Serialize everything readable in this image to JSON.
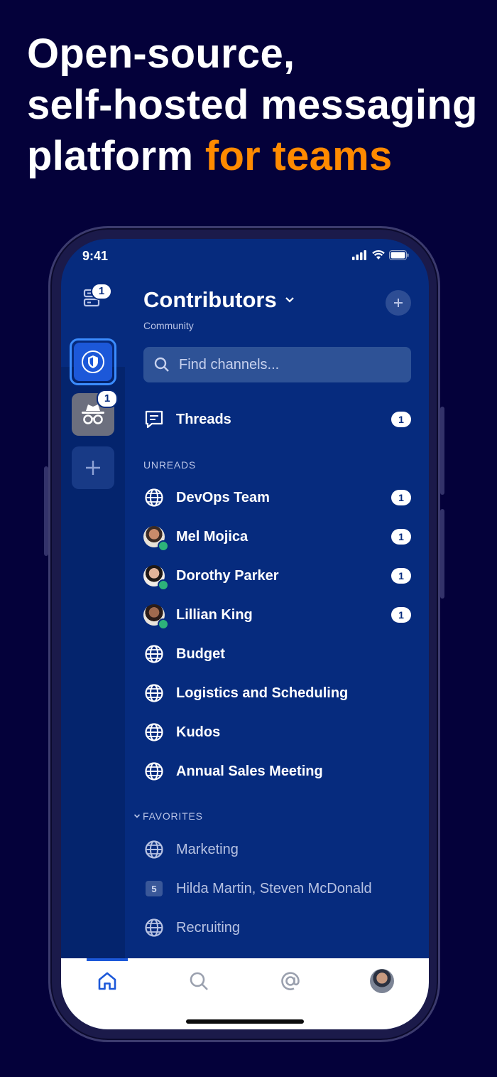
{
  "headline": {
    "line1": "Open-source,",
    "line2": "self-hosted messaging",
    "line3_plain": "platform ",
    "line3_accent": "for teams"
  },
  "colors": {
    "background": "#04013a",
    "accent": "#ff8a00",
    "sidebar": "#062b7e",
    "active_team": "#1c58d9",
    "online": "#2db37a"
  },
  "status_bar": {
    "time": "9:41",
    "icons": [
      "signal-icon",
      "wifi-icon",
      "battery-icon"
    ]
  },
  "team_rail": {
    "server_badge": "1",
    "incognito_badge": "1",
    "icons": [
      "server-icon",
      "shield-icon",
      "incognito-icon",
      "plus-icon"
    ]
  },
  "team": {
    "name": "Contributors",
    "subtitle": "Community"
  },
  "search": {
    "placeholder": "Find channels..."
  },
  "threads": {
    "label": "Threads",
    "count": "1"
  },
  "unreads": {
    "heading": "UNREADS",
    "items": [
      {
        "label": "DevOps Team",
        "type": "channel",
        "count": "1"
      },
      {
        "label": "Mel Mojica",
        "type": "dm",
        "count": "1"
      },
      {
        "label": "Dorothy Parker",
        "type": "dm",
        "count": "1"
      },
      {
        "label": "Lillian King",
        "type": "dm",
        "count": "1"
      },
      {
        "label": "Budget",
        "type": "channel"
      },
      {
        "label": "Logistics and Scheduling",
        "type": "channel"
      },
      {
        "label": "Kudos",
        "type": "channel"
      },
      {
        "label": "Annual Sales Meeting",
        "type": "channel"
      }
    ]
  },
  "favorites": {
    "heading": "FAVORITES",
    "items": [
      {
        "label": "Marketing",
        "type": "channel"
      },
      {
        "label": "Hilda Martin, Steven McDonald",
        "type": "group",
        "member_count": "5"
      },
      {
        "label": "Recruiting",
        "type": "channel"
      }
    ]
  },
  "tabbar": {
    "tabs": [
      "home-icon",
      "search-icon",
      "mention-icon",
      "profile-avatar"
    ],
    "active": "home"
  }
}
